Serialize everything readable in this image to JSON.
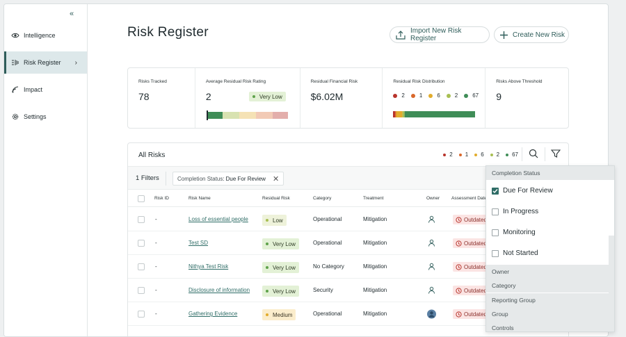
{
  "sidebar": {
    "collapse_label": "«",
    "items": [
      {
        "label": "Intelligence",
        "icon": "eye-icon"
      },
      {
        "label": "Risk Register",
        "icon": "register-icon",
        "active": true
      },
      {
        "label": "Impact",
        "icon": "signal-icon"
      },
      {
        "label": "Settings",
        "icon": "gear-icon"
      }
    ]
  },
  "header": {
    "title": "Risk Register",
    "import_label": "Import New Risk Register",
    "create_label": "Create New Risk"
  },
  "summary": {
    "risks_tracked_label": "Risks Tracked",
    "risks_tracked_value": "78",
    "avg_rating_label": "Average Residual Risk Rating",
    "avg_rating_value": "2",
    "avg_rating_badge": "Very Low",
    "financial_label": "Residual Financial Risk",
    "financial_value": "$6.02M",
    "distribution_label": "Residual Risk Distribution",
    "distribution": [
      {
        "count": "2",
        "color": "#b8342c"
      },
      {
        "count": "1",
        "color": "#d9682b"
      },
      {
        "count": "6",
        "color": "#e2ac2c"
      },
      {
        "count": "2",
        "color": "#a8bf53"
      },
      {
        "count": "67",
        "color": "#3f8d57"
      }
    ],
    "above_label": "Risks Above Threshold",
    "above_value": "9"
  },
  "table": {
    "title": "All Risks",
    "filters_count": "1 Filters",
    "filter_chip_key": "Completion Status",
    "filter_chip_sep": ":",
    "filter_chip_value": "Due For Review",
    "columns": [
      "Risk ID",
      "Risk Name",
      "Residual Risk",
      "Category",
      "Treatment",
      "Owner",
      "Assessment Date"
    ],
    "rows": [
      {
        "id": "-",
        "name": "Loss of essential people",
        "risk": "Low",
        "risk_level": "low",
        "category": "Operational",
        "treatment": "Mitigation",
        "assessment": "Outdated"
      },
      {
        "id": "-",
        "name": "Test SD",
        "risk": "Very Low",
        "risk_level": "vlow",
        "category": "Operational",
        "treatment": "Mitigation",
        "assessment": "Outdated"
      },
      {
        "id": "-",
        "name": "Nithya Test Risk",
        "risk": "Very Low",
        "risk_level": "vlow",
        "category": "No Category",
        "treatment": "Mitigation",
        "assessment": "Outdated"
      },
      {
        "id": "-",
        "name": "Disclosure of information",
        "risk": "Very Low",
        "risk_level": "vlow",
        "category": "Security",
        "treatment": "Mitigation",
        "assessment": "Outdated"
      },
      {
        "id": "-",
        "name": "Gathering Evidence",
        "risk": "Medium",
        "risk_level": "med",
        "category": "Operational",
        "treatment": "Mitigation",
        "assessment": "Outdated"
      }
    ]
  },
  "dropdown": {
    "completion_header": "Completion Status",
    "options": [
      {
        "label": "Due For Review",
        "checked": true
      },
      {
        "label": "In Progress",
        "checked": false
      },
      {
        "label": "Monitoring",
        "checked": false
      },
      {
        "label": "Not Started",
        "checked": false
      }
    ],
    "sections": [
      "Owner",
      "Category",
      "Reporting Group",
      "Group",
      "Controls"
    ]
  }
}
